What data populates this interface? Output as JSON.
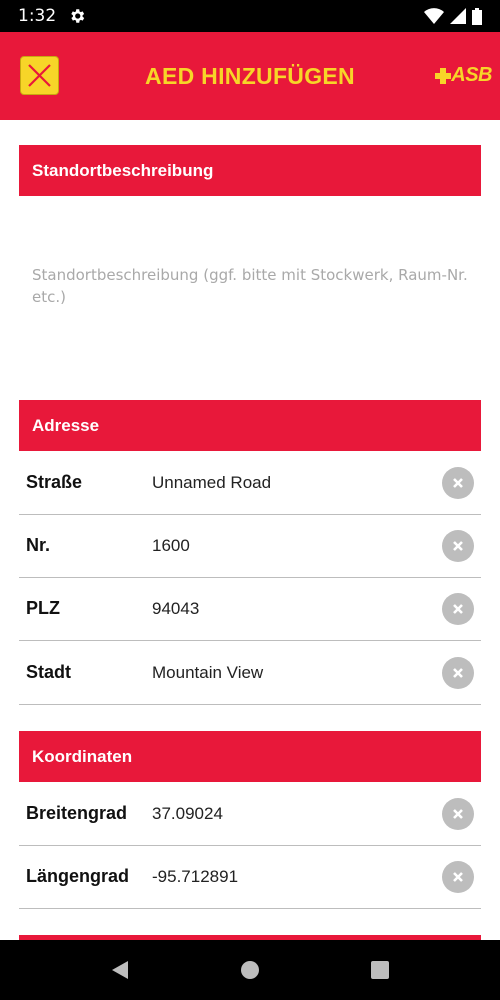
{
  "status_bar": {
    "time": "1:32"
  },
  "app_bar": {
    "title": "AED HINZUFÜGEN",
    "logo_text": "ASB"
  },
  "sections": {
    "description": {
      "header": "Standortbeschreibung",
      "placeholder": "Standortbeschreibung (ggf. bitte mit Stockwerk, Raum-Nr. etc.)"
    },
    "address": {
      "header": "Adresse",
      "street_label": "Straße",
      "street_value": "Unnamed Road",
      "number_label": "Nr.",
      "number_value": "1600",
      "zip_label": "PLZ",
      "zip_value": "94043",
      "city_label": "Stadt",
      "city_value": "Mountain View"
    },
    "coordinates": {
      "header": "Koordinaten",
      "lat_label": "Breitengrad",
      "lat_value": "37.09024",
      "lng_label": "Längengrad",
      "lng_value": "-95.712891"
    }
  },
  "colors": {
    "primary": "#e8183a",
    "accent": "#f7d528",
    "clear_button": "#bdbdbd"
  },
  "icons": {
    "status": [
      "gear-icon",
      "wifi-icon",
      "signal-icon",
      "battery-icon"
    ],
    "nav": [
      "back-icon",
      "home-icon",
      "recents-icon"
    ],
    "clear": "clear-icon",
    "close": "close-icon"
  }
}
